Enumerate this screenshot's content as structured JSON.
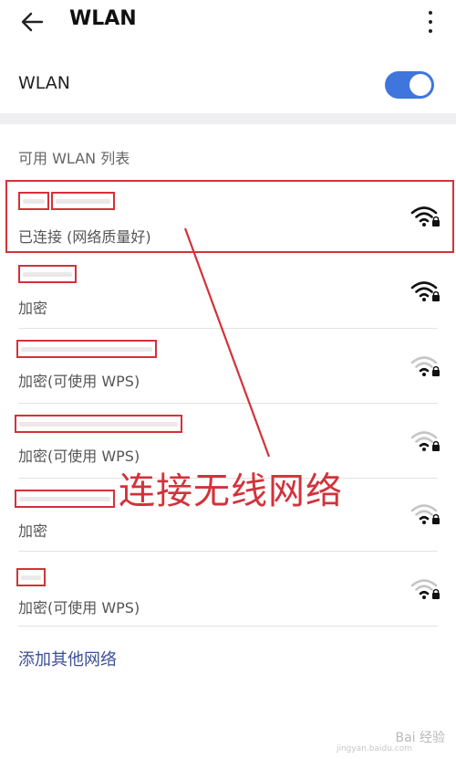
{
  "header": {
    "title": "WLAN",
    "back_icon": "arrow-left-icon",
    "more_icon": "more-vertical-icon"
  },
  "wlan_toggle": {
    "label": "WLAN",
    "enabled": true,
    "accent": "#3f76de"
  },
  "list": {
    "section_title": "可用 WLAN 列表",
    "networks": [
      {
        "status": "已连接 (网络质量好)",
        "icon": "wifi-locked-icon",
        "signal": "strong"
      },
      {
        "status": "加密",
        "icon": "wifi-locked-icon",
        "signal": "strong"
      },
      {
        "status": "加密(可使用 WPS)",
        "icon": "wifi-locked-icon",
        "signal": "weak"
      },
      {
        "status": "加密(可使用 WPS)",
        "icon": "wifi-locked-icon",
        "signal": "weak"
      },
      {
        "status": "加密",
        "icon": "wifi-locked-icon",
        "signal": "weak"
      },
      {
        "status": "加密(可使用 WPS)",
        "icon": "wifi-locked-icon",
        "signal": "weak"
      }
    ],
    "add_other": "添加其他网络"
  },
  "annotation": {
    "text": "连接无线网络",
    "color": "#d3323a"
  },
  "watermark": {
    "text": "Bai 经验",
    "sub": "jingyan.baidu.com"
  }
}
